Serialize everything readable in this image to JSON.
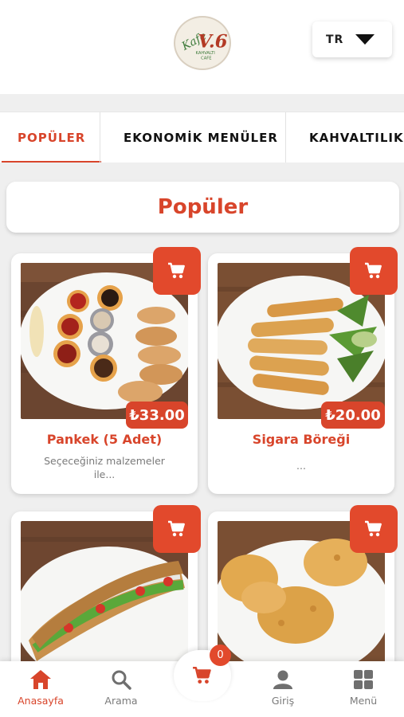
{
  "header": {
    "logo_text": "Kafe V.6",
    "logo_subtext": "KAHVALTI CAFE",
    "language": "TR"
  },
  "tabs": [
    {
      "label": "POPÜLER",
      "active": true
    },
    {
      "label": "EKONOMİK MENÜLER",
      "active": false
    },
    {
      "label": "KAHVALTILIKLA",
      "active": false
    }
  ],
  "section": {
    "title": "Popüler"
  },
  "products": [
    {
      "name": "Pankek (5 Adet)",
      "price": "₺33.00",
      "description": "Seçeceğiniz malzemeler ile..."
    },
    {
      "name": "Sigara Böreği",
      "price": "₺20.00",
      "description": "..."
    },
    {
      "name": "",
      "price": "",
      "description": ""
    },
    {
      "name": "",
      "price": "",
      "description": ""
    }
  ],
  "bottom_nav": {
    "home": "Anasayfa",
    "search": "Arama",
    "login": "Giriş",
    "menu": "Menü",
    "cart_count": "0"
  },
  "icons": {
    "cart": "cart-icon",
    "home": "home-icon",
    "search": "search-icon",
    "user": "user-icon",
    "grid": "grid-icon",
    "caret": "caret-down-icon"
  },
  "colors": {
    "accent": "#d8452b",
    "background": "#efefef",
    "card": "#ffffff"
  }
}
